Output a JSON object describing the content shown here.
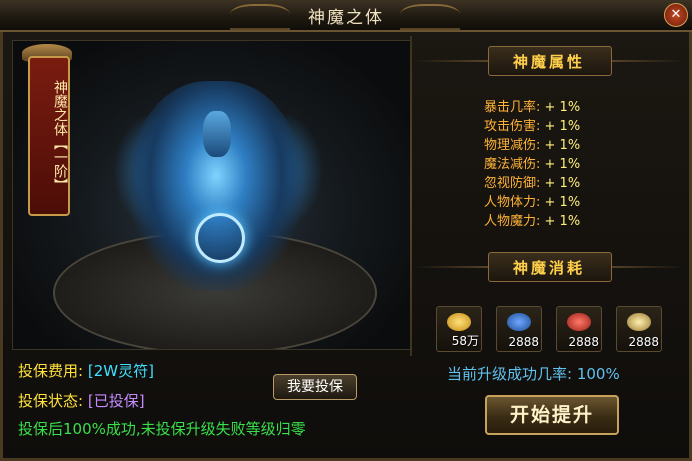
{
  "window": {
    "title": "神魔之体",
    "close_glyph": "✕"
  },
  "art": {
    "banner_text": "神魔之体【一阶】"
  },
  "attributes": {
    "header": "神魔属性",
    "rows": [
      {
        "name": "暴击几率:",
        "value": "+ 1%"
      },
      {
        "name": "攻击伤害:",
        "value": "+ 1%"
      },
      {
        "name": "物理减伤:",
        "value": "+ 1%"
      },
      {
        "name": "魔法减伤:",
        "value": "+ 1%"
      },
      {
        "name": "忽视防御:",
        "value": "+ 1%"
      },
      {
        "name": "人物体力:",
        "value": "+ 1%"
      },
      {
        "name": "人物魔力:",
        "value": "+ 1%"
      }
    ]
  },
  "cost": {
    "header": "神魔消耗",
    "items": [
      {
        "icon": "gold-ingot-icon",
        "qty": "58万",
        "color": "#f2c031"
      },
      {
        "icon": "blue-orb-icon",
        "qty": "2888",
        "color": "#2b6bc4"
      },
      {
        "icon": "red-orb-icon",
        "qty": "2888",
        "color": "#c4302b"
      },
      {
        "icon": "gold-crest-icon",
        "qty": "2888",
        "color": "#d9b25a"
      }
    ]
  },
  "upgrade": {
    "success_rate_text": "当前升级成功几率: 100%",
    "button_label": "开始提升"
  },
  "insurance": {
    "fee_label": "投保费用:",
    "fee_value": "[2W灵符]",
    "status_label": "投保状态:",
    "status_value": "[已投保]",
    "note": "投保后100%成功,未投保升级失败等级归零",
    "button_label": "我要投保"
  }
}
